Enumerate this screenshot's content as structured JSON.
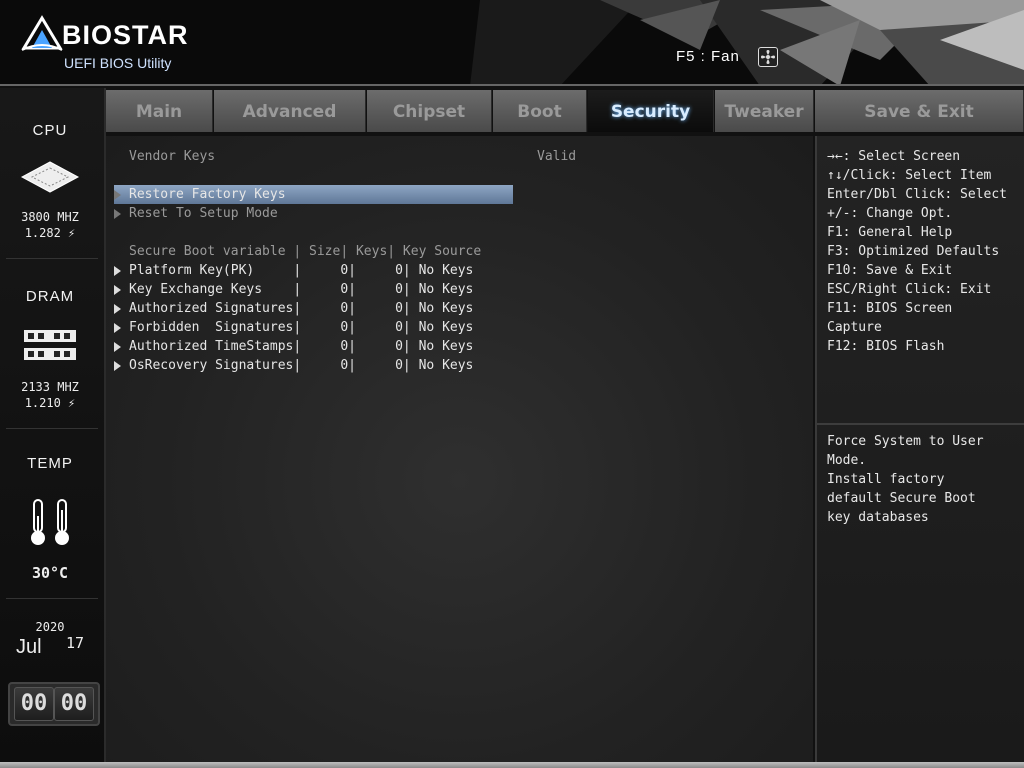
{
  "header": {
    "brand": "BIOSTAR",
    "subtitle": "UEFI BIOS Utility",
    "fan_hint": "F5 : Fan",
    "fan_icon": "fan-icon"
  },
  "status": {
    "cpu": {
      "label": "CPU",
      "freq": "3800 MHZ",
      "volt": "1.282 ⚡"
    },
    "dram": {
      "label": "DRAM",
      "freq": "2133 MHZ",
      "volt": "1.210 ⚡"
    },
    "temp": {
      "label": "TEMP",
      "value": "30°C"
    },
    "date": {
      "year": "2020",
      "month": "Jul",
      "day": "17"
    },
    "clock": {
      "hours": "00",
      "minutes": "00"
    }
  },
  "tabs": [
    {
      "label": "Main"
    },
    {
      "label": "Advanced"
    },
    {
      "label": "Chipset"
    },
    {
      "label": "Boot"
    },
    {
      "label": "Security",
      "active": true
    },
    {
      "label": "Tweaker"
    },
    {
      "label": "Save & Exit"
    }
  ],
  "security": {
    "vendor_keys_label": "Vendor Keys",
    "vendor_keys_value": "Valid",
    "restore_factory_keys": "Restore Factory Keys",
    "reset_setup_mode": "Reset To Setup Mode",
    "table_header": "Secure Boot variable | Size| Keys| Key Source",
    "rows": [
      "Platform Key(PK)     |     0|     0| No Keys",
      "Key Exchange Keys    |     0|     0| No Keys",
      "Authorized Signatures|     0|     0| No Keys",
      "Forbidden  Signatures|     0|     0| No Keys",
      "Authorized TimeStamps|     0|     0| No Keys",
      "OsRecovery Signatures|     0|     0| No Keys"
    ]
  },
  "help": {
    "keys": [
      "→←: Select Screen",
      "↑↓/Click: Select Item",
      "Enter/Dbl Click: Select",
      "+/-: Change Opt.",
      "F1: General Help",
      "F3: Optimized Defaults",
      "F10: Save & Exit",
      "ESC/Right Click: Exit",
      "F11: BIOS Screen",
      "Capture",
      "F12: BIOS Flash"
    ],
    "description": [
      "Force System to User",
      "Mode.",
      "Install factory",
      "default Secure Boot",
      "key databases"
    ]
  }
}
